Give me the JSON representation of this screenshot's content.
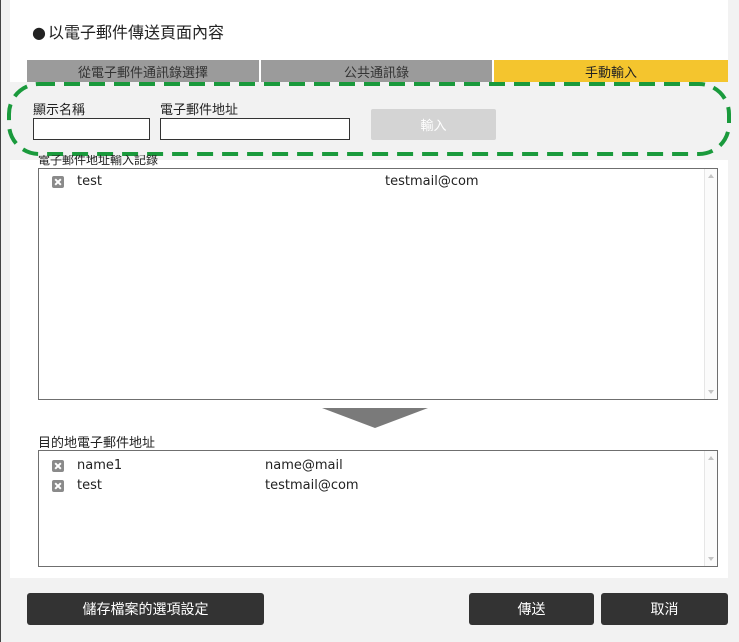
{
  "section": {
    "bullet": "●",
    "title": "以電子郵件傳送頁面內容"
  },
  "tabs": [
    {
      "label": "從電子郵件通訊錄選擇"
    },
    {
      "label": "公共通訊錄"
    },
    {
      "label": "手動輸入"
    }
  ],
  "manual_entry": {
    "display_name_label": "顯示名稱",
    "display_name_value": "",
    "email_label": "電子郵件地址",
    "email_value": "",
    "enter_button": "輸入"
  },
  "entry_list": {
    "label": "電子郵件地址輸入記錄",
    "rows": [
      {
        "name": "test",
        "email": "testmail@com"
      }
    ]
  },
  "destination": {
    "label": "目的地電子郵件地址",
    "rows": [
      {
        "name": "name1",
        "email": "name@mail"
      },
      {
        "name": "test",
        "email": "testmail@com"
      }
    ]
  },
  "footer": {
    "save_options": "儲存檔案的選項設定",
    "send": "傳送",
    "cancel": "取消"
  },
  "colors": {
    "active_tab": "#f4c52e",
    "inactive_tab": "#9b9b9b",
    "highlight_dash": "#1a9a3c",
    "dark_button": "#333333"
  }
}
